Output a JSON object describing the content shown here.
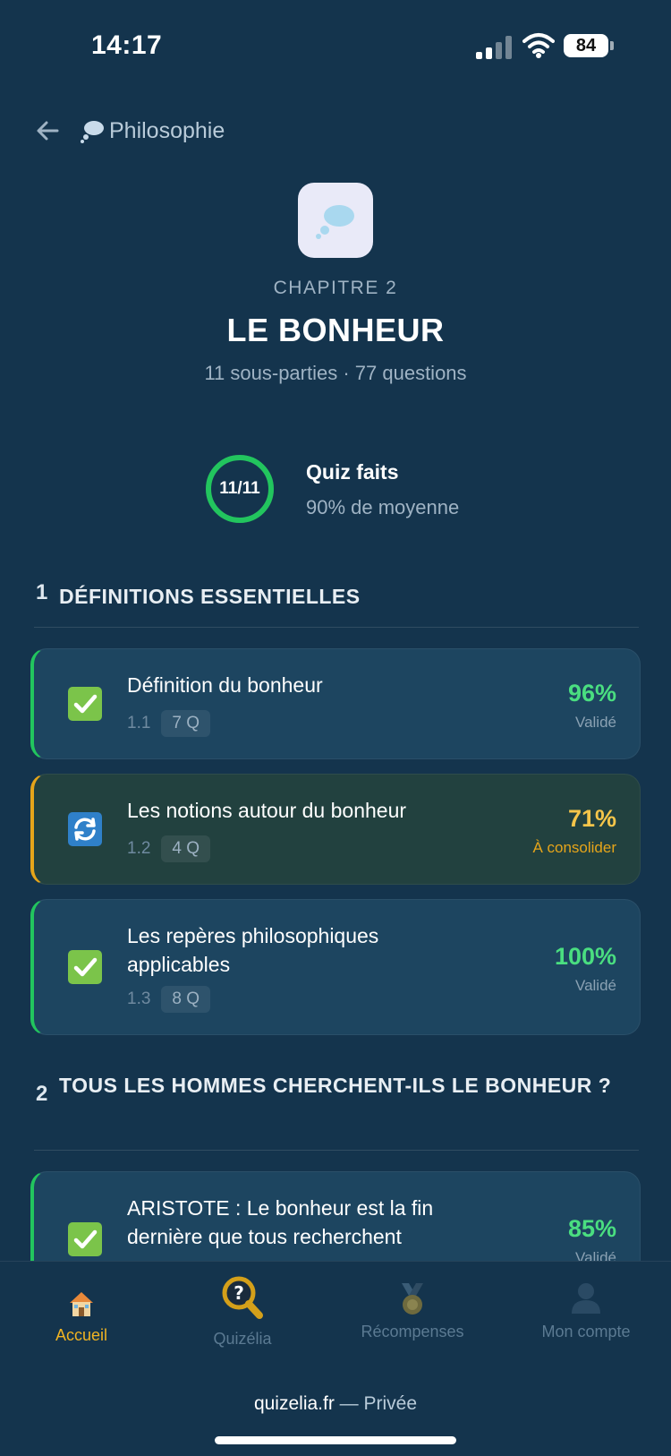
{
  "status": {
    "time": "14:17",
    "battery": "84"
  },
  "header": {
    "breadcrumb": "Philosophie"
  },
  "chapter": {
    "label": "CHAPITRE 2",
    "title": "LE BONHEUR",
    "subtitle": "11 sous-parties · 77 questions"
  },
  "progress": {
    "ring_label": "11/11",
    "ring_fraction": 1.0,
    "title": "Quiz faits",
    "subtitle": "90% de moyenne"
  },
  "sections": [
    {
      "number": "1",
      "title": "DÉFINITIONS ESSENTIELLES",
      "items": [
        {
          "title": "Définition du bonheur",
          "num": "1.1",
          "questions": "7 Q",
          "score": "96%",
          "status": "Validé"
        },
        {
          "title": "Les notions autour du bonheur",
          "num": "1.2",
          "questions": "4 Q",
          "score": "71%",
          "status": "À consolider"
        },
        {
          "title": "Les repères philosophiques applicables",
          "num": "1.3",
          "questions": "8 Q",
          "score": "100%",
          "status": "Validé"
        }
      ]
    },
    {
      "number": "2",
      "title": "TOUS LES HOMMES CHERCHENT-ILS LE BONHEUR ?",
      "items": [
        {
          "title": "ARISTOTE : Le bonheur est la fin dernière que tous recherchent",
          "score": "85%",
          "status": "Validé"
        }
      ]
    }
  ],
  "nav": {
    "tabs": [
      {
        "label": "Accueil",
        "icon": "house-icon",
        "active": true
      },
      {
        "label": "Quizélia",
        "icon": "magnifier-question-icon",
        "active": false
      },
      {
        "label": "Récompenses",
        "icon": "medal-icon",
        "active": false
      },
      {
        "label": "Mon compte",
        "icon": "user-icon",
        "active": false
      }
    ]
  },
  "footer": {
    "domain": "quizelia.fr",
    "separator": " — ",
    "mode": "Privée"
  },
  "colors": {
    "background": "#14344d",
    "card": "#1d4560",
    "success": "#4ade80",
    "warning": "#e6a51a",
    "active_tab": "#f0b322"
  }
}
